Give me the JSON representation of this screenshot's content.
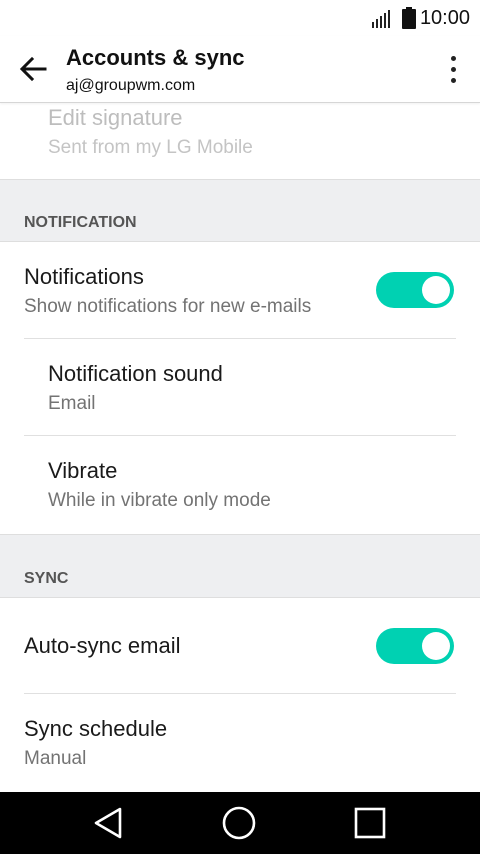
{
  "status_bar": {
    "time": "10:00"
  },
  "app_bar": {
    "title": "Accounts & sync",
    "subtitle": "aj@groupwm.com"
  },
  "edit_signature": {
    "title": "Edit signature",
    "subtitle": "Sent from my LG Mobile"
  },
  "sections": {
    "notification": {
      "header": "NOTIFICATION",
      "notifications": {
        "title": "Notifications",
        "subtitle": "Show notifications for new e-mails",
        "enabled": true
      },
      "notification_sound": {
        "title": "Notification sound",
        "subtitle": "Email"
      },
      "vibrate": {
        "title": "Vibrate",
        "subtitle": "While in vibrate only mode"
      }
    },
    "sync": {
      "header": "SYNC",
      "auto_sync": {
        "title": "Auto-sync email",
        "enabled": true
      },
      "sync_schedule": {
        "title": "Sync schedule",
        "subtitle": "Manual"
      }
    }
  },
  "colors": {
    "accent": "#00d1b2",
    "section_bg": "#eeeff1",
    "nav_bg": "#000000"
  },
  "icons": {
    "back": "arrow-left-icon",
    "overflow": "more-vert-icon",
    "signal": "signal-icon",
    "battery": "battery-icon",
    "nav_back": "triangle-back-icon",
    "nav_home": "circle-home-icon",
    "nav_recents": "square-recents-icon"
  }
}
